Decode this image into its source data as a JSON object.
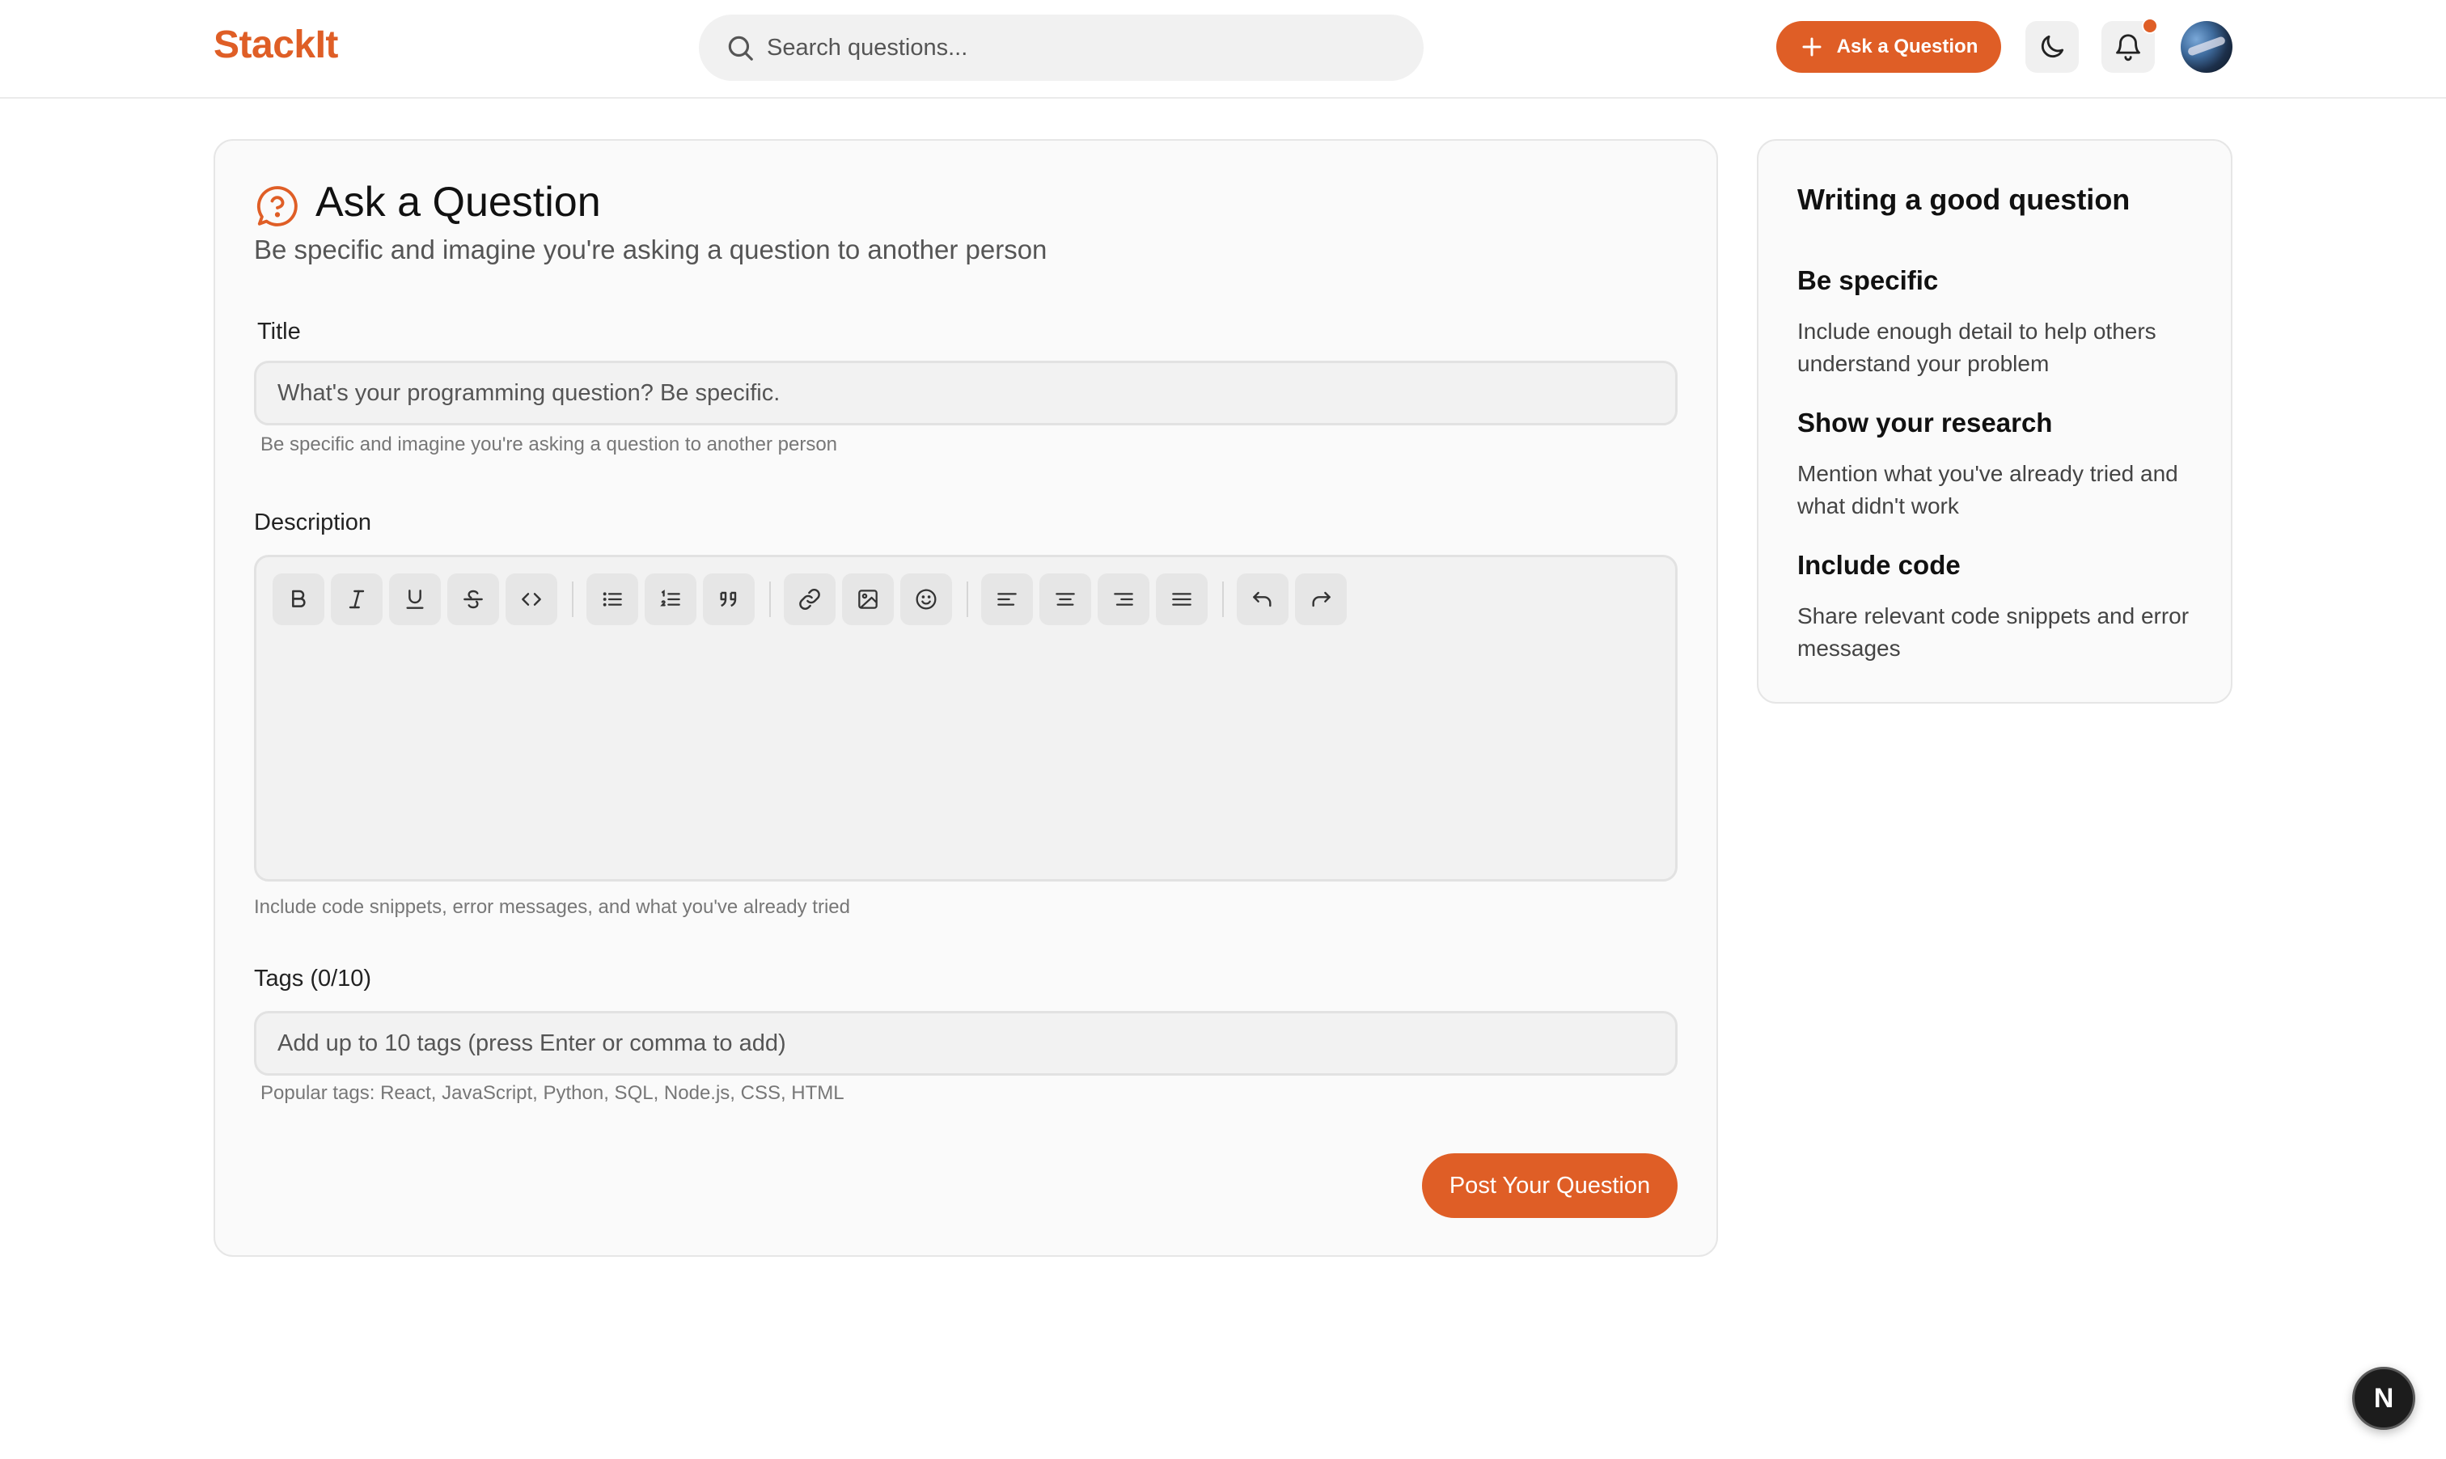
{
  "app": {
    "logo": "StackIt",
    "accent_color": "#df5e26"
  },
  "header": {
    "search_placeholder": "Search questions...",
    "ask_button_label": "Ask a Question",
    "theme_icon": "moon-icon",
    "notification_icon": "bell-icon",
    "has_notification": true
  },
  "form": {
    "title": "Ask a Question",
    "subtitle": "Be specific and imagine you're asking a question to another person",
    "title_field": {
      "label": "Title",
      "placeholder": "What's your programming question? Be specific.",
      "value": "",
      "hint": "Be specific and imagine you're asking a question to another person"
    },
    "description_field": {
      "label": "Description",
      "hint": "Include code snippets, error messages, and what you've already tried",
      "toolbar": [
        "bold-icon",
        "italic-icon",
        "underline-icon",
        "strikethrough-icon",
        "code-icon",
        "bullet-list-icon",
        "numbered-list-icon",
        "quote-icon",
        "link-icon",
        "image-icon",
        "emoji-icon",
        "align-left-icon",
        "align-center-icon",
        "align-right-icon",
        "align-justify-icon",
        "undo-icon",
        "redo-icon"
      ]
    },
    "tags_field": {
      "label": "Tags (0/10)",
      "placeholder": "Add up to 10 tags (press Enter or comma to add)",
      "hint": "Popular tags: React, JavaScript, Python, SQL, Node.js, CSS, HTML"
    },
    "submit_label": "Post Your Question"
  },
  "sidebar": {
    "title": "Writing a good question",
    "tips": [
      {
        "heading": "Be specific",
        "body": "Include enough detail to help others understand your problem"
      },
      {
        "heading": "Show your research",
        "body": "Mention what you've already tried and what didn't work"
      },
      {
        "heading": "Include code",
        "body": "Share relevant code snippets and error messages"
      }
    ]
  },
  "floating_badge": "N"
}
